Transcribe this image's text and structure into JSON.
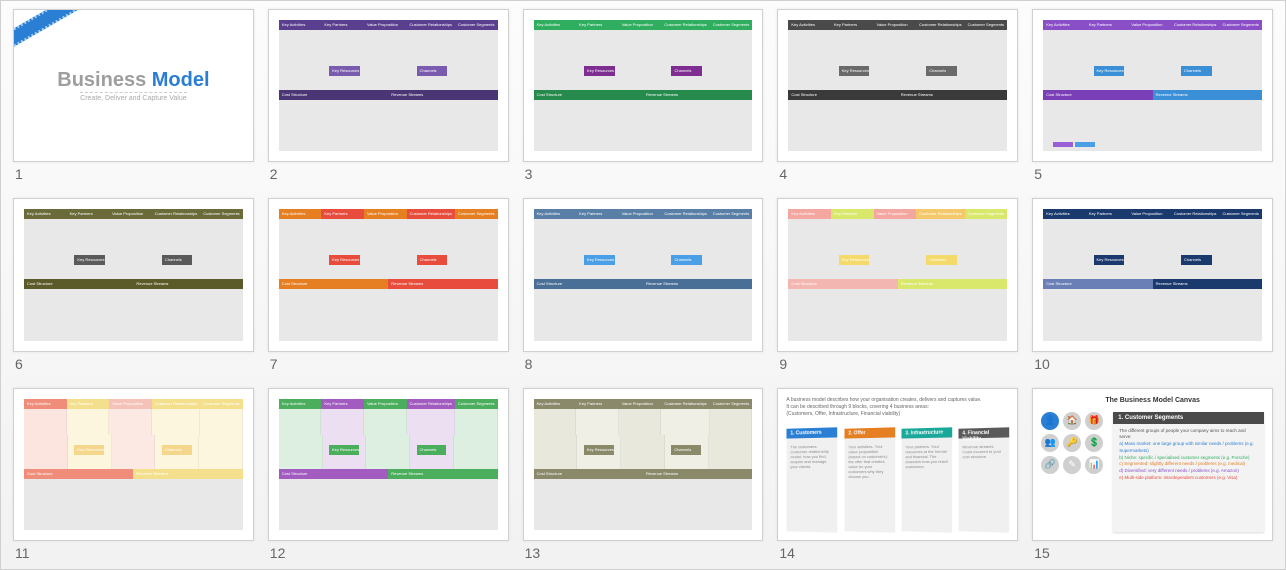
{
  "slides": [
    {
      "num": "1",
      "type": "title",
      "title_a": "Business ",
      "title_b": "Model",
      "subtitle": "Create, Deliver and Capture Value"
    },
    {
      "num": "2",
      "type": "canvas",
      "colors": {
        "top": [
          "#5a3f8e",
          "#5a3f8e",
          "#5a3f8e",
          "#5a3f8e",
          "#5a3f8e"
        ],
        "mid": "#7a5cae",
        "bot": [
          "#4a3575",
          "#4a3575"
        ]
      }
    },
    {
      "num": "3",
      "type": "canvas",
      "colors": {
        "top": [
          "#2fae60",
          "#2fae60",
          "#2fae60",
          "#2fae60",
          "#2fae60"
        ],
        "mid": "#7e2d91",
        "bot": [
          "#268a4c",
          "#268a4c"
        ]
      }
    },
    {
      "num": "4",
      "type": "canvas",
      "colors": {
        "top": [
          "#4a4a4a",
          "#4a4a4a",
          "#4a4a4a",
          "#4a4a4a",
          "#4a4a4a"
        ],
        "mid": "#6a6a6a",
        "bot": [
          "#3a3a3a",
          "#3a3a3a"
        ]
      }
    },
    {
      "num": "5",
      "type": "canvas",
      "colors": {
        "top": [
          "#8a4fc7",
          "#8a4fc7",
          "#8a4fc7",
          "#8a4fc7",
          "#8a4fc7"
        ],
        "mid": "#3a8fd6",
        "bot": [
          "#7a3fb7",
          "#3a8fd6"
        ]
      },
      "footer": [
        "#9a5fd7",
        "#4a9fe6"
      ]
    },
    {
      "num": "6",
      "type": "canvas",
      "colors": {
        "top": [
          "#6b6b3a",
          "#6b6b3a",
          "#6b6b3a",
          "#6b6b3a",
          "#6b6b3a"
        ],
        "mid": "#5a5a5a",
        "bot": [
          "#5b5b2a",
          "#5b5b2a"
        ]
      }
    },
    {
      "num": "7",
      "type": "canvas",
      "colors": {
        "top": [
          "#e67e22",
          "#e74c3c",
          "#e67e22",
          "#e74c3c",
          "#e67e22"
        ],
        "mid": "#e74c3c",
        "bot": [
          "#e67e22",
          "#e74c3c"
        ]
      }
    },
    {
      "num": "8",
      "type": "canvas",
      "colors": {
        "top": [
          "#5a7fa6",
          "#5a7fa6",
          "#5a7fa6",
          "#5a7fa6",
          "#5a7fa6"
        ],
        "mid": "#4a9fe6",
        "bot": [
          "#4a6f96",
          "#4a6f96"
        ]
      }
    },
    {
      "num": "9",
      "type": "canvas",
      "colors": {
        "top": [
          "#f4a6a0",
          "#d9e86b",
          "#f4a6a0",
          "#f4c96b",
          "#d9e86b"
        ],
        "mid": "#f4d96b",
        "bot": [
          "#f4b6b0",
          "#d9e86b"
        ]
      }
    },
    {
      "num": "10",
      "type": "canvas",
      "colors": {
        "top": [
          "#1a3a6e",
          "#1a3a6e",
          "#1a3a6e",
          "#1a3a6e",
          "#1a3a6e"
        ],
        "mid": "#1a3a6e",
        "bot": [
          "#6a7fb6",
          "#1a3a6e"
        ]
      }
    },
    {
      "num": "11",
      "type": "canvas",
      "fill": true,
      "colors": {
        "top": [
          "#f08c7a",
          "#f4e08c",
          "#f4c2b8",
          "#f4e08c",
          "#f4e08c"
        ],
        "mid": "#f4d68c",
        "bot": [
          "#f08c7a",
          "#f4e08c"
        ]
      },
      "fillColors": {
        "top": [
          "#fce4df",
          "#fdf6de",
          "#fce9e4",
          "#fdf6de",
          "#fdf6de"
        ],
        "bot": [
          "#fce4df",
          "#fdf6de"
        ]
      }
    },
    {
      "num": "12",
      "type": "canvas",
      "fill": true,
      "colors": {
        "top": [
          "#4aae5c",
          "#a25cc0",
          "#4aae5c",
          "#a25cc0",
          "#4aae5c"
        ],
        "mid": "#4aae5c",
        "bot": [
          "#a25cc0",
          "#4aae5c"
        ]
      },
      "fillColors": {
        "top": [
          "#dcefe0",
          "#ecdff2",
          "#dcefe0",
          "#ecdff2",
          "#dcefe0"
        ],
        "bot": [
          "#ecdff2",
          "#dcefe0"
        ]
      }
    },
    {
      "num": "13",
      "type": "canvas",
      "fill": true,
      "colors": {
        "top": [
          "#8a8a6a",
          "#8a8a6a",
          "#8a8a6a",
          "#8a8a6a",
          "#8a8a6a"
        ],
        "mid": "#8a8a6a",
        "bot": [
          "#8a8a6a",
          "#8a8a6a"
        ]
      },
      "fillColors": {
        "top": [
          "#e8e8dc",
          "#efefe6",
          "#e8e8dc",
          "#efefe6",
          "#e8e8dc"
        ],
        "bot": [
          "#efefe6",
          "#e8e8dc"
        ]
      }
    },
    {
      "num": "14",
      "type": "desc14",
      "intro1": "A business model describes how your organisation creates, delivers and captures value.",
      "intro2": "It can be described through 9 blocks, covering 4 business areas:",
      "intro3": "(Customers, Offer, Infrastructure, Financial viability)",
      "cards": [
        {
          "title": "1. Customers",
          "color": "#2a7fd4",
          "body": "The customers. Customer relationship model: how you find, acquire and manage your clients."
        },
        {
          "title": "2. Offer",
          "color": "#e67e22",
          "body": "Your activities. Your value proposition (based on customers): the offer that creates value for your customers why they choose you."
        },
        {
          "title": "3. Infrastructure",
          "color": "#1aa89a",
          "body": "Your partners. Your resources at the human and financial. The channels how you reach customers."
        },
        {
          "title": "4. Financial Viability",
          "color": "#5a5a5a",
          "body": "Revenue streams. Costs incurred to your cost structure."
        }
      ]
    },
    {
      "num": "15",
      "type": "desc15",
      "title": "The Business Model Canvas",
      "panel_title": "1. Customer Segments",
      "panel_intro": "The different groups of people your company aims to reach and serve:",
      "bullets": [
        "a) Mass market: one large group with similar needs / problems (e.g. Supermarkets)",
        "b) Niche: specific / specialised customer segments (e.g. Porsche)",
        "c) Segmented: slightly different needs / problems (e.g. medical)",
        "d) Diversified: very different needs / problems (e.g. Amazon)",
        "e) Multi-side platform: interdependent customers (e.g. Visa)"
      ],
      "bullet_colors": [
        "#2a7fd4",
        "#2fae60",
        "#e67e22",
        "#8a4fc7",
        "#e74c3c"
      ],
      "icons": [
        "👤",
        "🏠",
        "🎁",
        "👥",
        "🔑",
        "💲",
        "🔗",
        "✎",
        "📊"
      ]
    }
  ],
  "canvas_labels": {
    "top": [
      "Key Activities",
      "Key Partners",
      "Value Proposition",
      "Customer Relationships",
      "Customer Segments"
    ],
    "mid": [
      "Key Resources",
      "Channels"
    ],
    "bot": [
      "Cost Structure",
      "Revenue Streams"
    ]
  }
}
